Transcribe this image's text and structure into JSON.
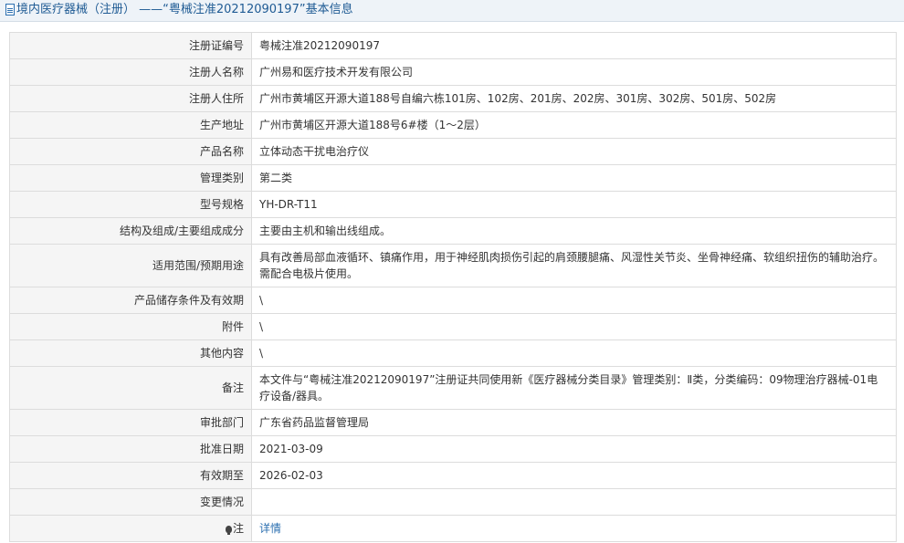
{
  "header": {
    "title": "境内医疗器械（注册） ——“粤械注准20212090197”基本信息"
  },
  "rows": [
    {
      "label": "注册证编号",
      "value": "粤械注准20212090197"
    },
    {
      "label": "注册人名称",
      "value": "广州易和医疗技术开发有限公司"
    },
    {
      "label": "注册人住所",
      "value": "广州市黄埔区开源大道188号自编六栋101房、102房、201房、202房、301房、302房、501房、502房"
    },
    {
      "label": "生产地址",
      "value": "广州市黄埔区开源大道188号6#楼（1～2层）"
    },
    {
      "label": "产品名称",
      "value": "立体动态干扰电治疗仪"
    },
    {
      "label": "管理类别",
      "value": "第二类"
    },
    {
      "label": "型号规格",
      "value": "YH-DR-T11"
    },
    {
      "label": "结构及组成/主要组成成分",
      "value": "主要由主机和输出线组成。"
    },
    {
      "label": "适用范围/预期用途",
      "value": "具有改善局部血液循环、镇痛作用，用于神经肌肉损伤引起的肩颈腰腿痛、风湿性关节炎、坐骨神经痛、软组织扭伤的辅助治疗。需配合电极片使用。"
    },
    {
      "label": "产品储存条件及有效期",
      "value": "\\"
    },
    {
      "label": "附件",
      "value": "\\"
    },
    {
      "label": "其他内容",
      "value": "\\"
    },
    {
      "label": "备注",
      "value": "本文件与“粤械注准20212090197”注册证共同使用新《医疗器械分类目录》管理类别：Ⅱ类，分类编码：09物理治疗器械-01电疗设备/器具。"
    },
    {
      "label": "审批部门",
      "value": "广东省药品监督管理局"
    },
    {
      "label": "批准日期",
      "value": "2021-03-09"
    },
    {
      "label": "有效期至",
      "value": "2026-02-03"
    },
    {
      "label": "变更情况",
      "value": ""
    }
  ],
  "note": {
    "label": "注",
    "icon": "bulb-icon",
    "link_text": "详情"
  }
}
